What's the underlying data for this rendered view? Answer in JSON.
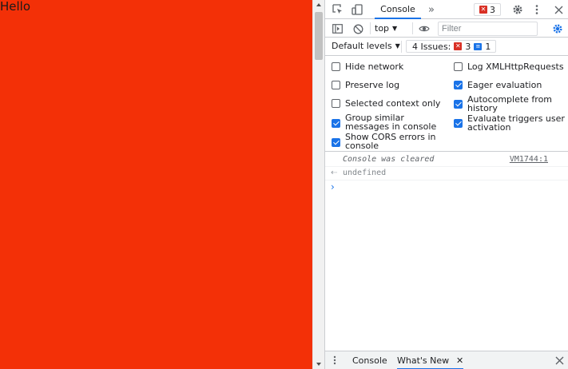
{
  "page": {
    "text": "Hello",
    "background": "#f33007"
  },
  "devtools": {
    "tabs": {
      "active": "Console",
      "more": "»"
    },
    "issues_badge": {
      "count": "3"
    },
    "toolbar": {
      "context": "top",
      "filter_placeholder": "Filter"
    },
    "levels": {
      "label": "Default levels",
      "issues_label": "4 Issues:",
      "issues_errors": "3",
      "issues_info": "1"
    },
    "settings": {
      "left": [
        {
          "label": "Hide network",
          "checked": false
        },
        {
          "label": "Preserve log",
          "checked": false
        },
        {
          "label": "Selected context only",
          "checked": false
        },
        {
          "label": "Group similar messages in console",
          "checked": true
        },
        {
          "label": "Show CORS errors in console",
          "checked": true
        }
      ],
      "right": [
        {
          "label": "Log XMLHttpRequests",
          "checked": false
        },
        {
          "label": "Eager evaluation",
          "checked": true
        },
        {
          "label": "Autocomplete from history",
          "checked": true
        },
        {
          "label": "Evaluate triggers user activation",
          "checked": true
        }
      ]
    },
    "console": {
      "cleared_message": "Console was cleared",
      "cleared_source": "VM1744:1",
      "result_value": "undefined"
    },
    "drawer": {
      "tab_console": "Console",
      "tab_whats_new": "What's New"
    }
  },
  "colors": {
    "accent": "#1a73e8",
    "error": "#d93025"
  },
  "icons": {
    "inspect": "inspect-element-icon",
    "device": "device-toolbar-icon",
    "settings": "gear-icon",
    "menu": "kebab-menu-icon",
    "close": "close-icon",
    "sidebar": "sidebar-toggle-icon",
    "clear": "clear-console-icon",
    "eye": "eye-icon"
  }
}
